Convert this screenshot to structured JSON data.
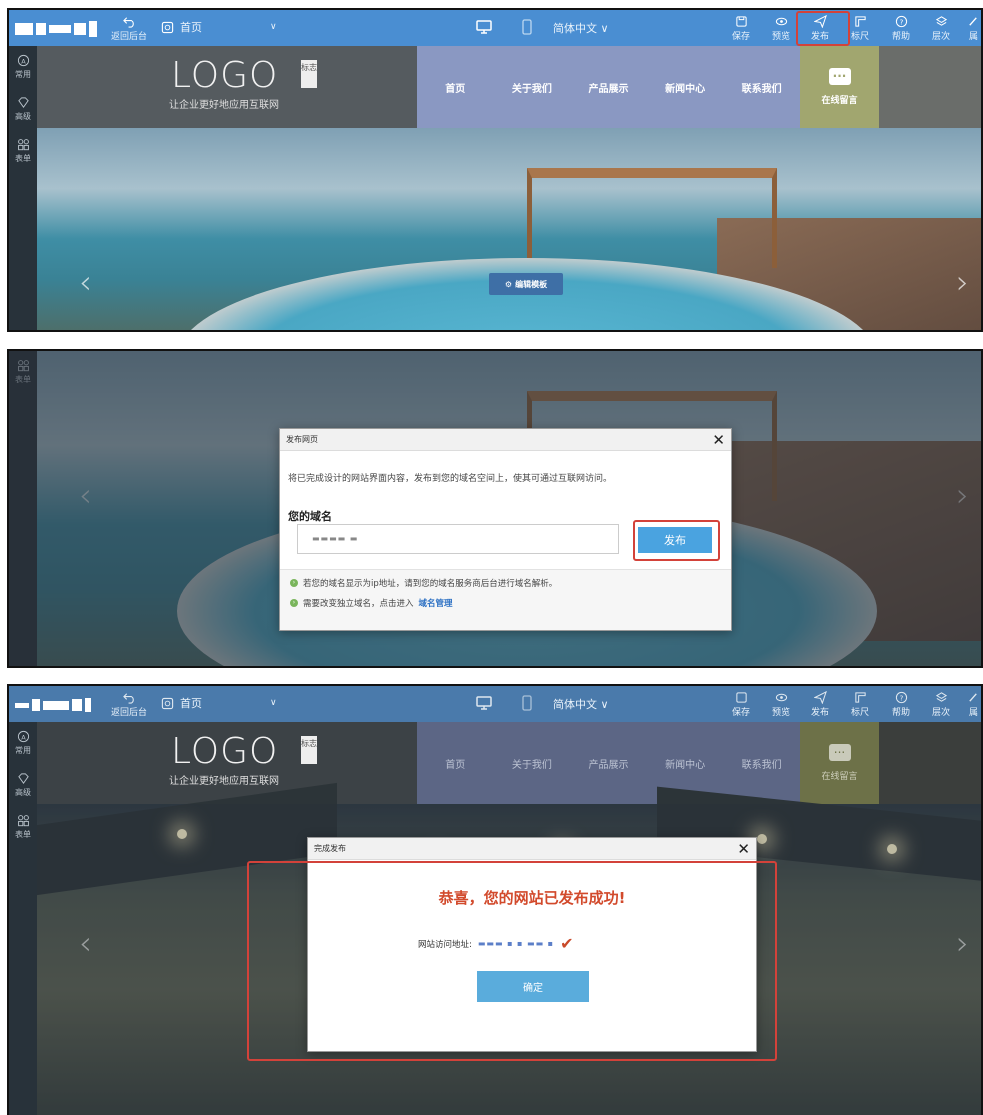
{
  "toolbar": {
    "back_label": "返回后台",
    "page_label": "首页",
    "language_label": "简体中文",
    "save_label": "保存",
    "preview_label": "预览",
    "publish_label": "发布",
    "ruler_label": "标尺",
    "help_label": "帮助",
    "layers_label": "层次",
    "attributes_label": "属"
  },
  "sidebar": {
    "common_label": "常用",
    "advanced_label": "高级",
    "form_label": "表单"
  },
  "site": {
    "logo_text": "LOGO",
    "logo_badge": "标志",
    "slogan": "让企业更好地应用互联网",
    "nav": [
      "首页",
      "关于我们",
      "产品展示",
      "新闻中心",
      "联系我们"
    ],
    "online_message": "在线留言",
    "edit_template": "编辑模板"
  },
  "publish_dialog": {
    "title": "发布网页",
    "intro": "将已完成设计的网站界面内容，发布到您的域名空间上，使其可通过互联网访问。",
    "domain_label": "您的域名",
    "domain_value": "▬▬▬▬  ▬",
    "publish_button": "发布",
    "note1": "若您的域名显示为ip地址，请到您的域名服务商后台进行域名解析。",
    "note2_prefix": "需要改变独立域名，点击进入",
    "note2_link": "域名管理"
  },
  "done_dialog": {
    "title": "完成发布",
    "message": "恭喜，您的网站已发布成功!",
    "address_label": "网站访问地址:",
    "address_value": "▬▬▬ ▪ ▪ ▬▬ ▪",
    "confirm_button": "确定"
  },
  "colors": {
    "toolbar_blue": "#4a8ed2",
    "highlight_red": "#d3423a",
    "publish_button_blue": "#4aa3e0",
    "success_text": "#d24a2c"
  }
}
